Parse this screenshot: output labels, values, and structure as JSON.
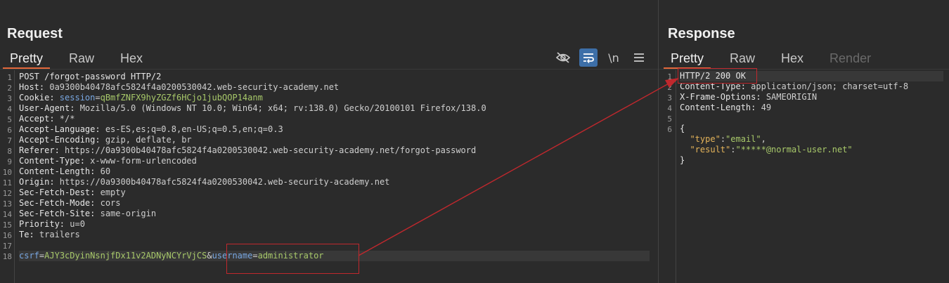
{
  "request": {
    "title": "Request",
    "tabs": [
      "Pretty",
      "Raw",
      "Hex"
    ],
    "toolbar_icons": [
      "eye-slash-icon",
      "word-wrap-icon",
      "newline-icon",
      "menu-icon"
    ],
    "newline_label": "\\n",
    "line_numbers": [
      "1",
      "2",
      "3",
      "4",
      "5",
      "6",
      "7",
      "8",
      "9",
      "10",
      "11",
      "12",
      "13",
      "14",
      "15",
      "16",
      "17",
      "18"
    ],
    "lines": {
      "l1": "POST /forgot-password HTTP/2",
      "l2_key": "Host:",
      "l2_val": " 0a9300b40478afc5824f4a0200530042.web-security-academy.net",
      "l3_key": "Cookie:",
      "l3_ck": " session",
      "l3_eq": "=",
      "l3_cv": "qBmfZNFX9hyZGZf6HCjo1jubQOP14anm",
      "l4_key": "User-Agent:",
      "l4_val": " Mozilla/5.0 (Windows NT 10.0; Win64; x64; rv:138.0) Gecko/20100101 Firefox/138.0",
      "l5_key": "Accept:",
      "l5_val": " */*",
      "l6_key": "Accept-Language:",
      "l6_val": " es-ES,es;q=0.8,en-US;q=0.5,en;q=0.3",
      "l7_key": "Accept-Encoding:",
      "l7_val": " gzip, deflate, br",
      "l8_key": "Referer:",
      "l8_val": " https://0a9300b40478afc5824f4a0200530042.web-security-academy.net/forgot-password",
      "l9_key": "Content-Type:",
      "l9_val": " x-www-form-urlencoded",
      "l10_key": "Content-Length:",
      "l10_val": " 60",
      "l11_key": "Origin:",
      "l11_val": " https://0a9300b40478afc5824f4a0200530042.web-security-academy.net",
      "l12_key": "Sec-Fetch-Dest:",
      "l12_val": " empty",
      "l13_key": "Sec-Fetch-Mode:",
      "l13_val": " cors",
      "l14_key": "Sec-Fetch-Site:",
      "l14_val": " same-origin",
      "l15_key": "Priority:",
      "l15_val": " u=0",
      "l16_key": "Te:",
      "l16_val": " trailers",
      "l18_p1n": "csrf",
      "l18_eq1": "=",
      "l18_p1v": "AJY3cDyinNsnjfDx11v2ADNyNCYrVjCS",
      "l18_amp": "&",
      "l18_p2n": "username",
      "l18_eq2": "=",
      "l18_p2v": "administrator"
    }
  },
  "response": {
    "title": "Response",
    "tabs": [
      "Pretty",
      "Raw",
      "Hex",
      "Render"
    ],
    "line_numbers": [
      "1",
      "2",
      "3",
      "4",
      "5",
      "6"
    ],
    "lines": {
      "l1": "HTTP/2 200 OK",
      "l2_key": "Content-Type:",
      "l2_val": " application/json; charset=utf-8",
      "l3_key": "X-Frame-Options:",
      "l3_val": " SAMEORIGIN",
      "l4_key": "Content-Length:",
      "l4_val": " 49",
      "l6": "{",
      "j1_key": "\"type\"",
      "j1_colon": ":",
      "j1_val": "\"email\"",
      "j1_comma": ",",
      "j2_key": "\"result\"",
      "j2_colon": ":",
      "j2_val": "\"*****@normal-user.net\"",
      "jend": "}"
    }
  },
  "annotation_color": "#c0282d"
}
